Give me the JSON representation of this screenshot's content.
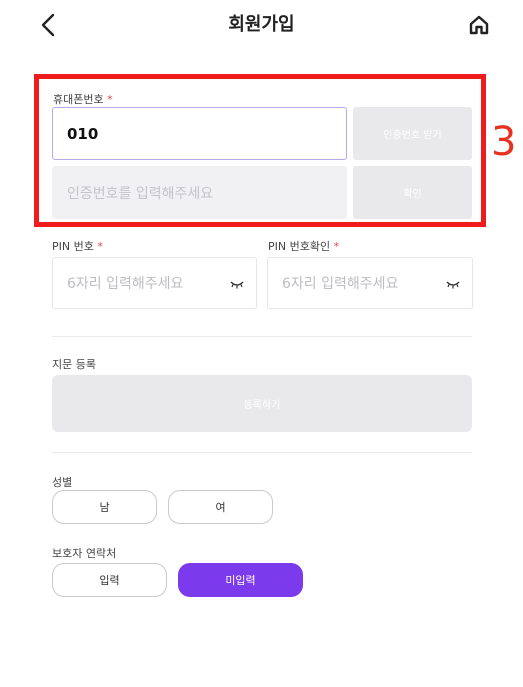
{
  "header": {
    "title": "회원가입",
    "back_icon": "chevron-left-icon",
    "home_icon": "home-icon"
  },
  "phone": {
    "label": "휴대폰번호",
    "required_mark": "*",
    "value": "010",
    "request_button": "인증번호 받기",
    "code_placeholder": "인증번호를 입력해주세요",
    "confirm_button": "확인"
  },
  "pin": {
    "label": "PIN 번호",
    "required_mark": "*",
    "placeholder": "6자리 입력해주세요",
    "confirm_label": "PIN 번호확인",
    "confirm_required_mark": "*",
    "confirm_placeholder": "6자리 입력해주세요",
    "toggle_icon": "eye-closed-icon"
  },
  "fingerprint": {
    "label": "지문 등록",
    "button": "등록하기"
  },
  "gender": {
    "label": "성별",
    "options": [
      "남",
      "여"
    ]
  },
  "guardian": {
    "label": "보호자 연락처",
    "options": [
      "입력",
      "미입력"
    ],
    "selected": "미입력"
  },
  "annotation": {
    "step": "3",
    "color": "#ee1c1c"
  },
  "colors": {
    "accent": "#7c3aed"
  }
}
